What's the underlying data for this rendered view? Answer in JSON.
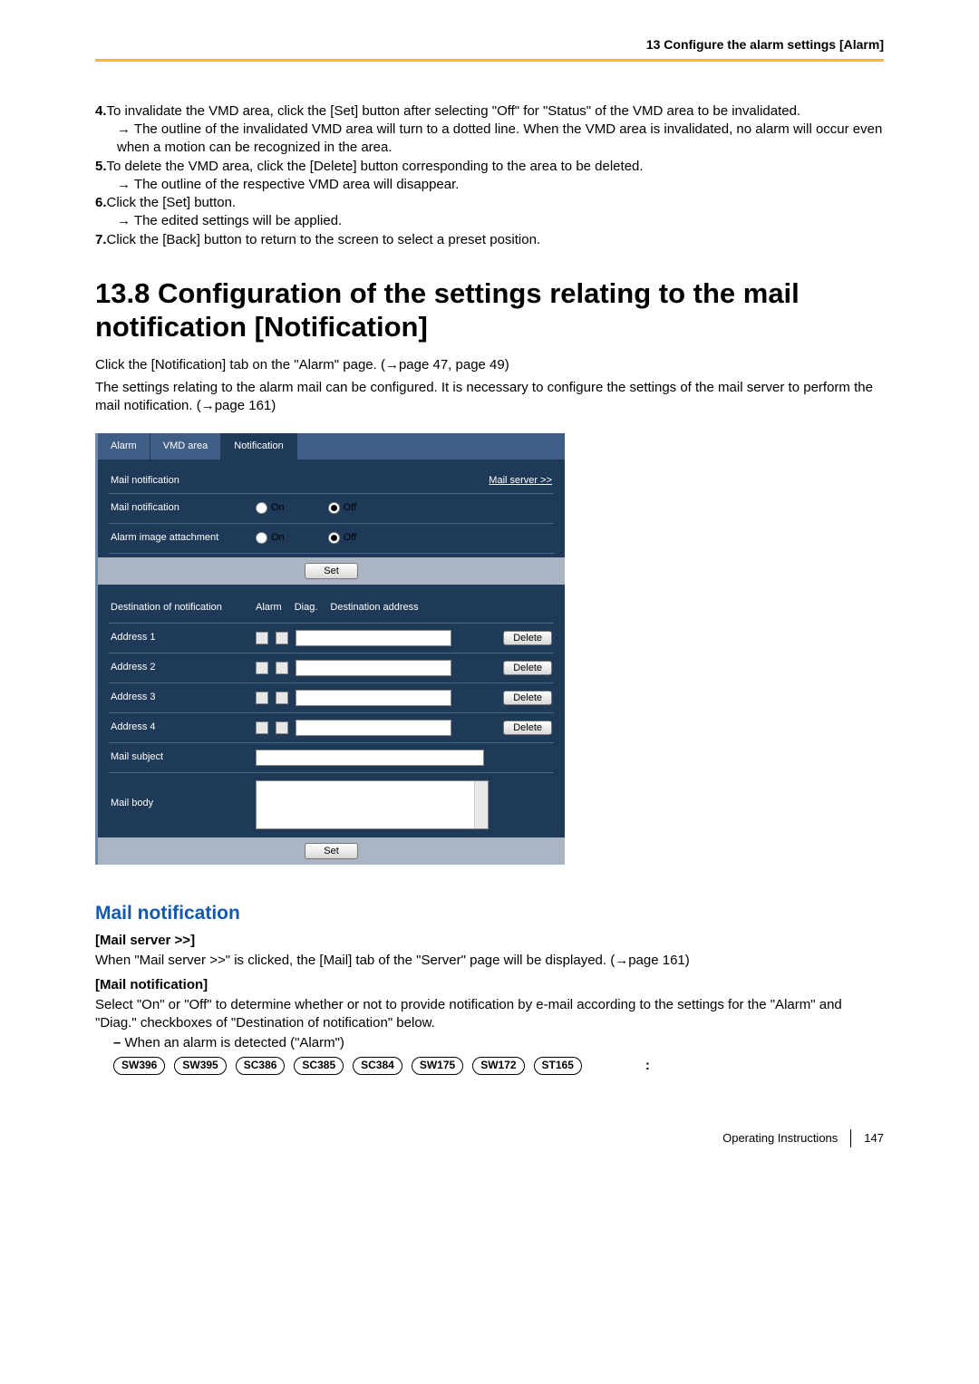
{
  "header": {
    "chapter": "13 Configure the alarm settings [Alarm]"
  },
  "steps": [
    {
      "num": "4.",
      "text": "To invalidate the VMD area, click the [Set] button after selecting \"Off\" for \"Status\" of the VMD area to be invalidated.",
      "arrow": "The outline of the invalidated VMD area will turn to a dotted line. When the VMD area is invalidated, no alarm will occur even when a motion can be recognized in the area."
    },
    {
      "num": "5.",
      "text": "To delete the VMD area, click the [Delete] button corresponding to the area to be deleted.",
      "arrow": "The outline of the respective VMD area will disappear."
    },
    {
      "num": "6.",
      "text": "Click the [Set] button.",
      "arrow": "The edited settings will be applied."
    },
    {
      "num": "7.",
      "text": "Click the [Back] button to return to the screen to select a preset position."
    }
  ],
  "section": {
    "title": "13.8  Configuration of the settings relating to the mail notification [Notification]",
    "intro1": "Click the [Notification] tab on the \"Alarm\" page. (→page 47, page 49)",
    "intro2": "The settings relating to the alarm mail can be configured. It is necessary to configure the settings of the mail server to perform the mail notification. (→page 161)"
  },
  "panel": {
    "tabs": [
      "Alarm",
      "VMD area",
      "Notification"
    ],
    "active_tab": 2,
    "group1_title": "Mail notification",
    "mail_server_link": "Mail server >>",
    "rows": {
      "mail_notif_label": "Mail notification",
      "attach_label": "Alarm image attachment",
      "on": "On",
      "off": "Off"
    },
    "set_label": "Set",
    "group2_title": "Destination of notification",
    "cols": {
      "alarm": "Alarm",
      "diag": "Diag.",
      "dest": "Destination address"
    },
    "addresses": [
      "Address 1",
      "Address 2",
      "Address 3",
      "Address 4"
    ],
    "delete_label": "Delete",
    "mail_subject_label": "Mail subject",
    "mail_body_label": "Mail body"
  },
  "explain": {
    "heading": "Mail notification",
    "h1": "[Mail server >>]",
    "p1": "When \"Mail server >>\" is clicked, the [Mail] tab of the \"Server\" page will be displayed. (→page 161)",
    "h2": "[Mail notification]",
    "p2": "Select \"On\" or \"Off\" to determine whether or not to provide notification by e-mail according to the settings for the \"Alarm\" and \"Diag.\" checkboxes of \"Destination of notification\" below.",
    "bullet": "When an alarm is detected (\"Alarm\")",
    "models": [
      "SW396",
      "SW395",
      "SC386",
      "SC385",
      "SC384",
      "SW175",
      "SW172",
      "ST165"
    ],
    "colon": ":"
  },
  "footer": {
    "label": "Operating Instructions",
    "page": "147"
  }
}
